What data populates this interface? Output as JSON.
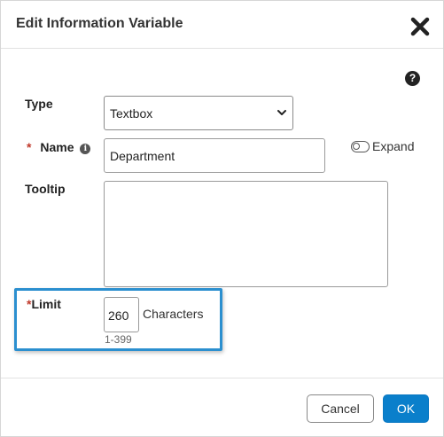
{
  "dialog": {
    "title": "Edit Information Variable",
    "close_icon": "close-icon",
    "help_icon": "question-circle-icon",
    "help_glyph": "?"
  },
  "fields": {
    "type": {
      "label": "Type",
      "value": "Textbox",
      "chevron_icon": "chevron-down-icon"
    },
    "name": {
      "required_mark": "*",
      "label": "Name",
      "info_icon": "info-circle-icon",
      "info_glyph": "i",
      "value": "Department"
    },
    "expand": {
      "label": "Expand",
      "icon": "toggle-off-icon"
    },
    "tooltip": {
      "label": "Tooltip",
      "value": ""
    },
    "limit": {
      "required_mark": "*",
      "label": "Limit",
      "value": "260",
      "unit": "Characters",
      "range": "1-399"
    }
  },
  "footer": {
    "cancel_label": "Cancel",
    "ok_label": "OK"
  },
  "colors": {
    "accent": "#0a7fcb",
    "highlight": "#2b8fcf",
    "required": "#c0392b"
  }
}
